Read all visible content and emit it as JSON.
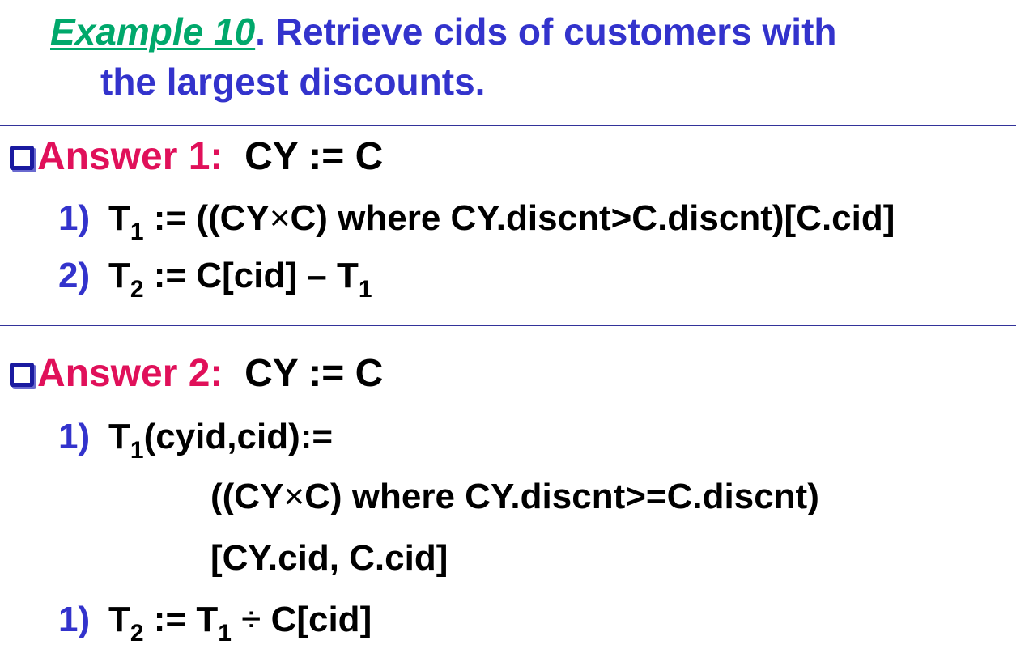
{
  "title": {
    "example_label": "Example 10",
    "line1_rest": ". Retrieve cids of customers with",
    "line2": "the largest discounts."
  },
  "answer1": {
    "label": "Answer 1:",
    "assign": "CY := C",
    "steps": [
      {
        "num": "1)",
        "var": "T",
        "sub": "1",
        "expr_a": " := ((CY",
        "op": "×",
        "expr_b": "C) where CY.discnt>C.discnt)[C.cid]"
      },
      {
        "num": "2)",
        "var": "T",
        "sub": "2",
        "expr_a": " := C[cid] ",
        "op": "–",
        "expr_b": " T",
        "sub2": "1"
      }
    ]
  },
  "answer2": {
    "label": "Answer 2:",
    "assign": "CY := C",
    "steps": [
      {
        "num": "1)",
        "var": "T",
        "sub": "1",
        "expr": "(cyid,cid):="
      },
      {
        "cont_a": "((CY",
        "op": "×",
        "cont_b": "C) where CY.discnt>=C.discnt)"
      },
      {
        "cont": "[CY.cid, C.cid]"
      },
      {
        "num": "1)",
        "var": "T",
        "sub": "2",
        "expr_a": " := T",
        "sub2": "1",
        "op": " ÷ ",
        "expr_b": "C[cid]"
      }
    ]
  }
}
